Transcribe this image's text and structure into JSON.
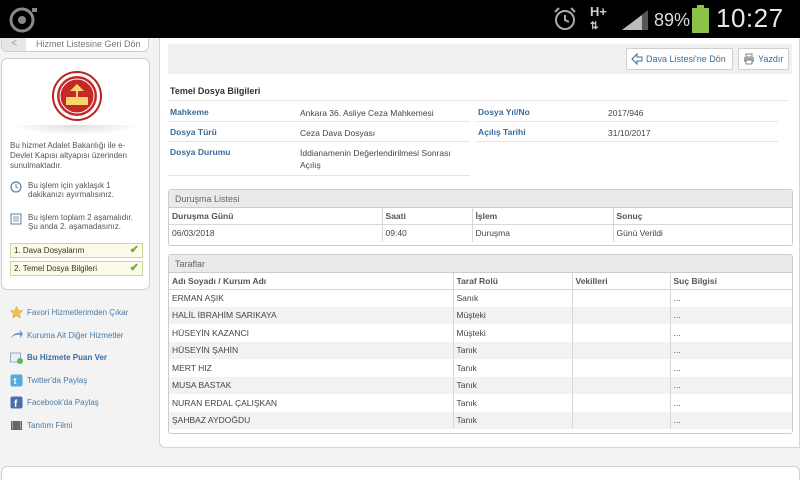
{
  "status_bar": {
    "network": "H+",
    "battery": "89%",
    "time": "10:27"
  },
  "sidebar": {
    "back_label": "Hizmet Listesine Geri Dön",
    "info": "Bu hizmet Adalet Bakanlığı ile e-Devlet Kapısı altyapısı üzerinden sunulmaktadır.",
    "time_note": "Bu işlem için yaklaşık 1 dakikanızı ayırmalısınız.",
    "step_note": "Bu işlem toplam 2 aşamalıdır. Şu anda 2. aşamadasınız.",
    "steps": [
      {
        "label": "1. Dava Dosyalarım"
      },
      {
        "label": "2. Temel Dosya Bilgileri"
      }
    ],
    "links": [
      {
        "label": "Favori Hizmetlerimden Çıkar",
        "icon": "star-icon"
      },
      {
        "label": "Kuruma Ait Diğer Hizmetler",
        "icon": "arrow-icon"
      },
      {
        "label": "Bu Hizmete Puan Ver",
        "icon": "rate-icon"
      },
      {
        "label": "Twitter'da Paylaş",
        "icon": "twitter-icon"
      },
      {
        "label": "Facebook'da Paylaş",
        "icon": "facebook-icon"
      },
      {
        "label": "Tanıtım Filmi",
        "icon": "film-icon"
      }
    ]
  },
  "toolbar": {
    "back_to_list": "Dava Listesi'ne Dön",
    "print": "Yazdır"
  },
  "file_info": {
    "title": "Temel Dosya Bilgileri",
    "mahkeme_label": "Mahkeme",
    "mahkeme_value": "Ankara 36. Asliye Ceza Mahkemesi",
    "yil_no_label": "Dosya Yıl/No",
    "yil_no_value": "2017/946",
    "turu_label": "Dosya Türü",
    "turu_value": "Ceza Dava Dosyası",
    "acilis_label": "Açılış Tarihi",
    "acilis_value": "31/10/2017",
    "durum_label": "Dosya Durumu",
    "durum_value_1": "İddianamenin Değerlendirilmesi Sonrası",
    "durum_value_2": "Açılış"
  },
  "hearings": {
    "title": "Duruşma Listesi",
    "headers": [
      "Duruşma Günü",
      "Saati",
      "İşlem",
      "Sonuç"
    ],
    "rows": [
      [
        "06/03/2018",
        "09:40",
        "Duruşma",
        "Günü Verildi"
      ]
    ]
  },
  "parties": {
    "title": "Taraflar",
    "headers": [
      "Adı Soyadı / Kurum Adı",
      "Taraf Rolü",
      "Vekilleri",
      "Suç Bilgisi"
    ],
    "rows": [
      [
        "ERMAN AŞIK",
        "Sanık",
        "",
        "..."
      ],
      [
        "HALİL İBRAHİM SARIKAYA",
        "Müşteki",
        "",
        "..."
      ],
      [
        "HÜSEYİN KAZANCI",
        "Müşteki",
        "",
        "..."
      ],
      [
        "HÜSEYİN ŞAHİN",
        "Tanık",
        "",
        "..."
      ],
      [
        "MERT HIZ",
        "Tanık",
        "",
        "..."
      ],
      [
        "MUSA BASTAK",
        "Tanık",
        "",
        "..."
      ],
      [
        "NURAN ERDAL ÇALIŞKAN",
        "Tanık",
        "",
        "..."
      ],
      [
        "ŞAHBAZ AYDOĞDU",
        "Tanık",
        "",
        "..."
      ]
    ]
  }
}
